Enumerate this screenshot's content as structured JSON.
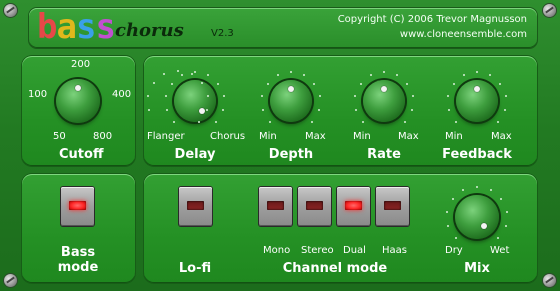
{
  "header": {
    "logo_letters": [
      "b",
      "a",
      "s",
      "s"
    ],
    "logo_word": "chorus",
    "version": "V2.3",
    "copyright": "Copyright (C) 2006 Trevor Magnusson",
    "website": "www.cloneensemble.com"
  },
  "cutoff": {
    "label": "Cutoff",
    "scale": {
      "top": "200",
      "left": "100",
      "right": "400",
      "bottom_left": "50",
      "bottom_right": "800"
    }
  },
  "delay": {
    "label": "Delay",
    "min": "Flanger",
    "max": "Chorus"
  },
  "depth": {
    "label": "Depth",
    "min": "Min",
    "max": "Max"
  },
  "rate": {
    "label": "Rate",
    "min": "Min",
    "max": "Max"
  },
  "feedback": {
    "label": "Feedback",
    "min": "Min",
    "max": "Max"
  },
  "bass_mode": {
    "label_line1": "Bass",
    "label_line2": "mode",
    "on": true
  },
  "lofi": {
    "label": "Lo-fi",
    "on": false
  },
  "channel_mode": {
    "label": "Channel mode",
    "options": [
      {
        "label": "Mono",
        "on": false
      },
      {
        "label": "Stereo",
        "on": false
      },
      {
        "label": "Dual",
        "on": true
      },
      {
        "label": "Haas",
        "on": false
      }
    ]
  },
  "mix": {
    "label": "Mix",
    "min": "Dry",
    "max": "Wet"
  },
  "colors": {
    "panel": "#2a962a",
    "led_on": "#ff2a2a",
    "led_off": "#7a1f1f",
    "text": "#ffffff"
  }
}
